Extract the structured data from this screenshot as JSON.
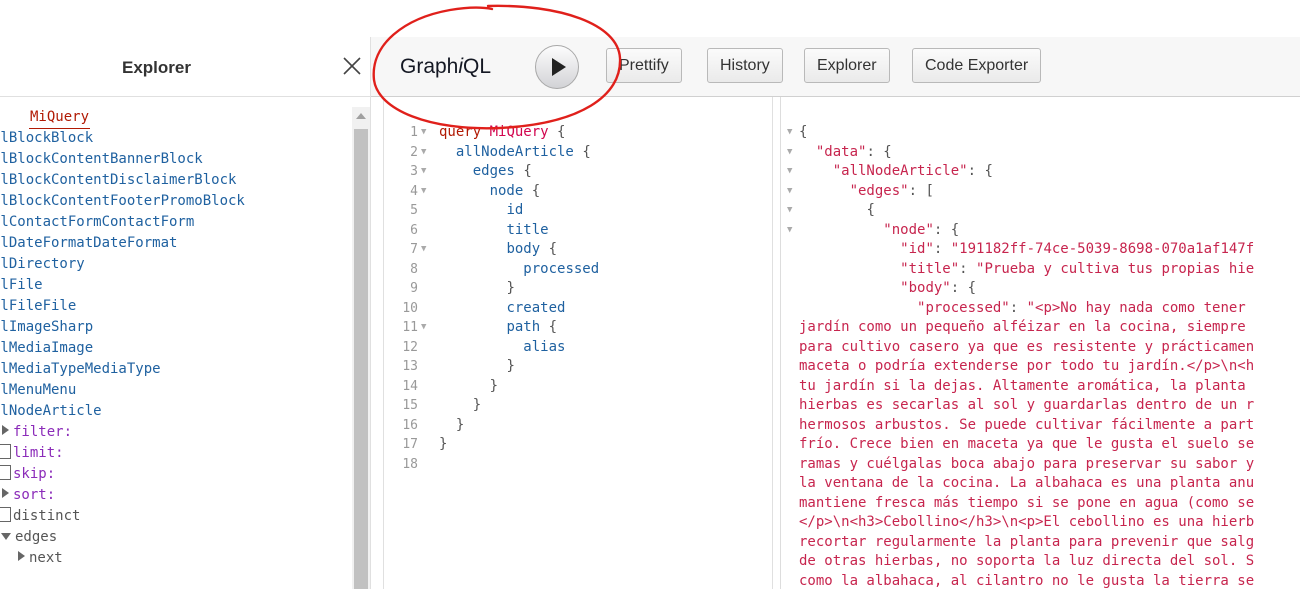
{
  "explorer": {
    "title": "Explorer",
    "query_keyword": "ry",
    "query_name": "MiQuery",
    "fields": [
      "llBlockBlock",
      "llBlockContentBannerBlock",
      "llBlockContentDisclaimerBlock",
      "llBlockContentFooterPromoBlock",
      "llContactFormContactForm",
      "llDateFormatDateFormat",
      "llDirectory",
      "llFile",
      "llFileFile",
      "llImageSharp",
      "llMediaImage",
      "llMediaTypeMediaType",
      "llMenuMenu",
      "llNodeArticle"
    ],
    "args": {
      "filter": "filter:",
      "limit": "limit:",
      "skip": "skip:",
      "sort": "sort:",
      "distinct": "distinct",
      "edges": "edges",
      "next": "next"
    }
  },
  "toolbar": {
    "title_prefix": "Graph",
    "title_italic": "i",
    "title_suffix": "QL",
    "buttons": {
      "prettify": "Prettify",
      "history": "History",
      "explorer": "Explorer",
      "code_exporter": "Code Exporter"
    }
  },
  "query": {
    "line_numbers": [
      "1",
      "2",
      "3",
      "4",
      "5",
      "6",
      "7",
      "8",
      "9",
      "10",
      "11",
      "12",
      "13",
      "14",
      "15",
      "16",
      "17",
      "18"
    ],
    "l1_kw": "query",
    "l1_name": "MiQuery",
    "l1_brace": "{",
    "l2_field": "allNodeArticle",
    "l3_field": "edges",
    "l4_field": "node",
    "l5_field": "id",
    "l6_field": "title",
    "l7_field": "body",
    "l8_field": "processed",
    "l10_field": "created",
    "l11_field": "path",
    "l12_field": "alias",
    "open_brace": "{",
    "close_brace": "}"
  },
  "result": {
    "l1": "{",
    "k_data": "\"data\"",
    "k_all": "\"allNodeArticle\"",
    "k_edges": "\"edges\"",
    "bracket": "[",
    "l5": "{",
    "k_node": "\"node\"",
    "k_id": "\"id\"",
    "v_id": "\"191182ff-74ce-5039-8698-070a1af147f",
    "k_title": "\"title\"",
    "v_title": "\"Prueba y cultiva tus propias hie",
    "k_body": "\"body\"",
    "k_processed": "\"processed\"",
    "v_processed": "\"<p>No hay nada como tener",
    "wrapped": [
      "jardín como un pequeño alféizar en la cocina, siempre",
      "para cultivo casero ya que es resistente y prácticamen",
      "maceta o podría extenderse por todo tu jardín.</p>\\n<h",
      "tu jardín si la dejas. Altamente aromática, la planta",
      "hierbas es secarlas al sol y guardarlas dentro de un r",
      "hermosos arbustos. Se puede cultivar fácilmente a part",
      "frío. Crece bien en maceta ya que le gusta el suelo se",
      "ramas y cuélgalas boca abajo para preservar su sabor y",
      "la ventana de la cocina. La albahaca es una planta anu",
      "mantiene fresca más tiempo si se pone en agua (como se",
      "</p>\\n<h3>Cebollino</h3>\\n<p>El cebollino es una hierb",
      "recortar regularmente la planta para prevenir que salg",
      "de otras hierbas, no soporta la luz directa del sol. S",
      "como la albahaca, al cilantro no le gusta la tierra se"
    ]
  },
  "colors": {
    "annotation": "#e0201b"
  }
}
